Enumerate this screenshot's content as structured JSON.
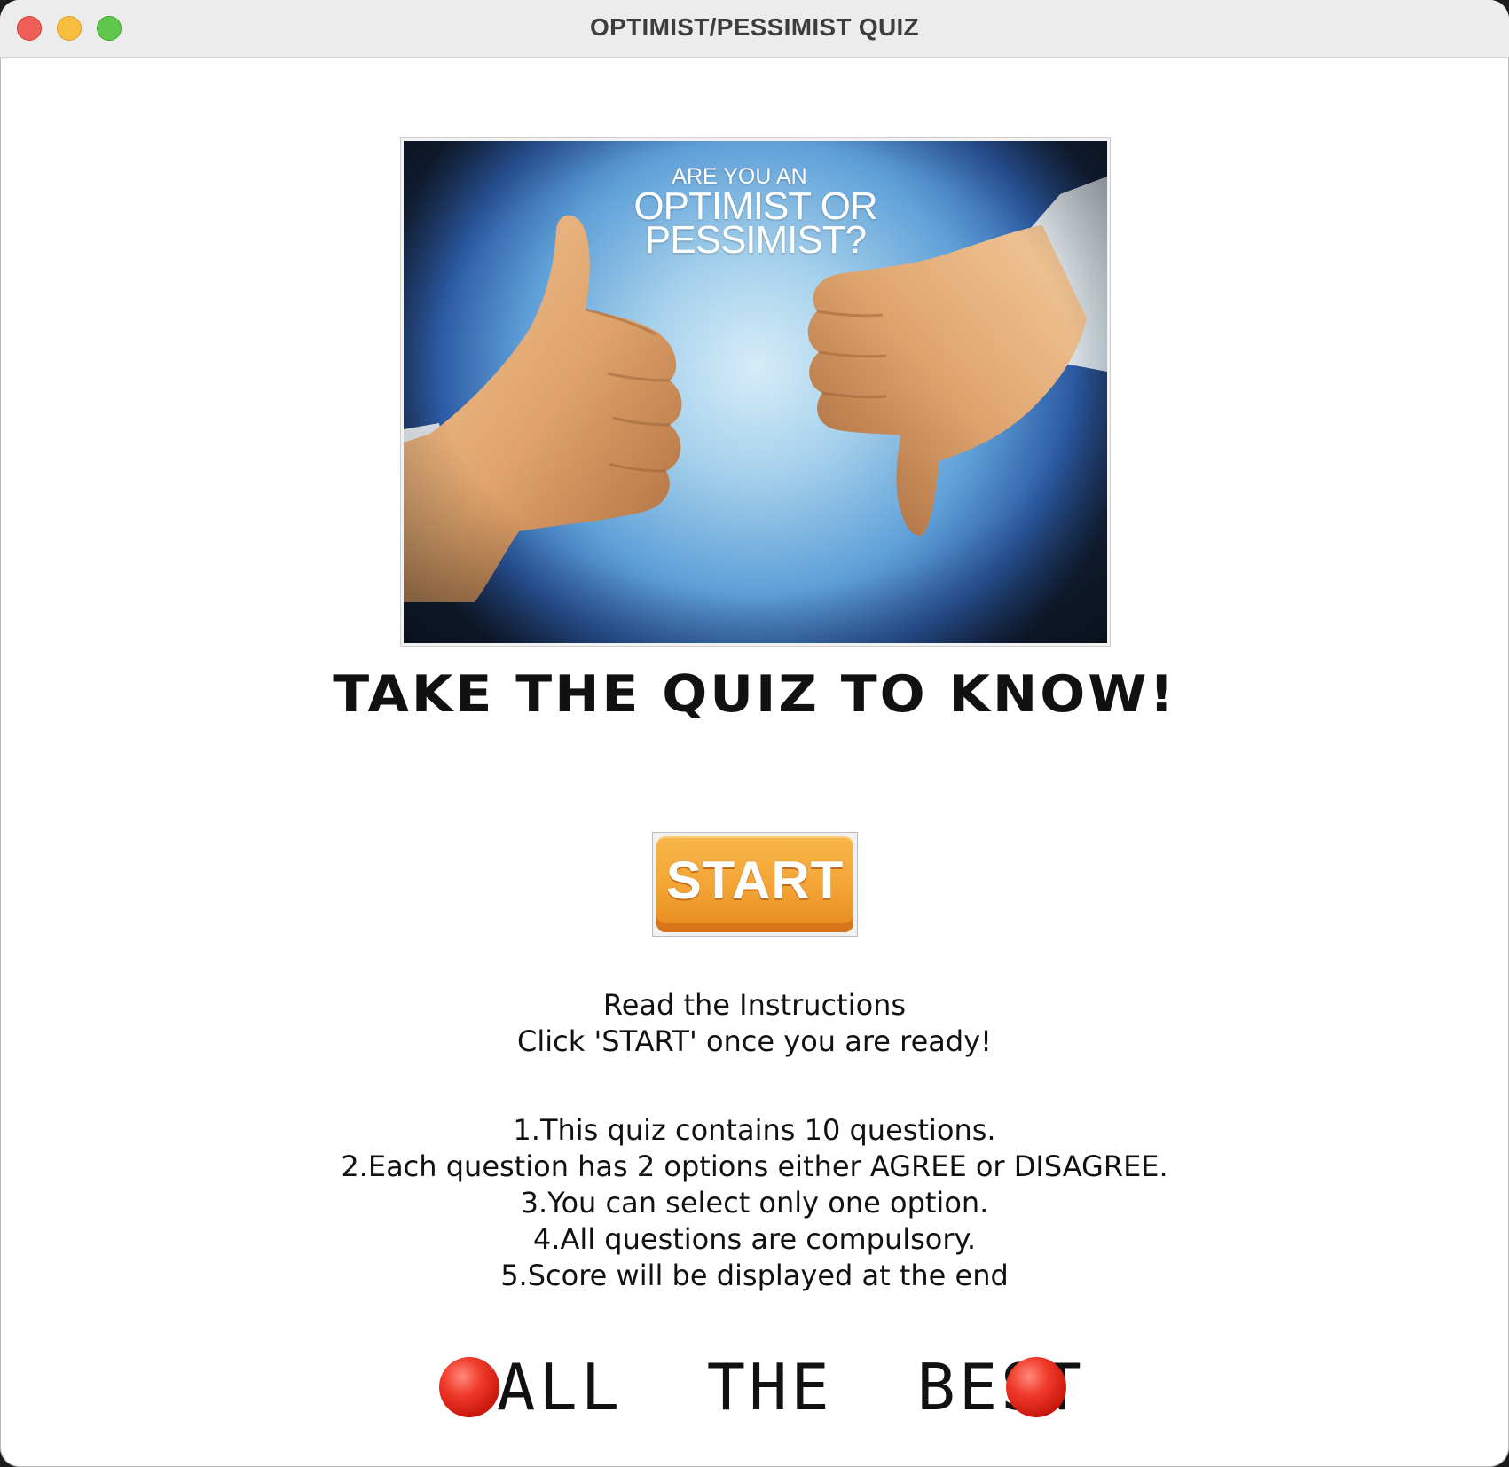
{
  "window": {
    "title": "OPTIMIST/PESSIMIST QUIZ"
  },
  "hero": {
    "caption_line1": "ARE YOU AN",
    "caption_line2": "OPTIMIST OR",
    "caption_line3": "PESSIMIST?"
  },
  "heading": "TAKE THE QUIZ TO KNOW!",
  "start_button": {
    "label": "START"
  },
  "instructions": {
    "line1": "Read the Instructions",
    "line2": "Click 'START' once you are ready!"
  },
  "rules": [
    "1.This quiz contains 10 questions.",
    "2.Each question has 2 options either AGREE or DISAGREE.",
    "3.You can select only one option.",
    "4.All questions are compulsory.",
    "5.Score will be displayed at the end"
  ],
  "footer": {
    "text": "ALL THE BEST",
    "icon_left": "red-circle-icon",
    "icon_right": "red-circle-icon"
  },
  "colors": {
    "start_button": "#f3a334",
    "circle": "#e02a1e",
    "close": "#ee5f58",
    "minimize": "#f5be3e",
    "maximize": "#5fc84c"
  }
}
